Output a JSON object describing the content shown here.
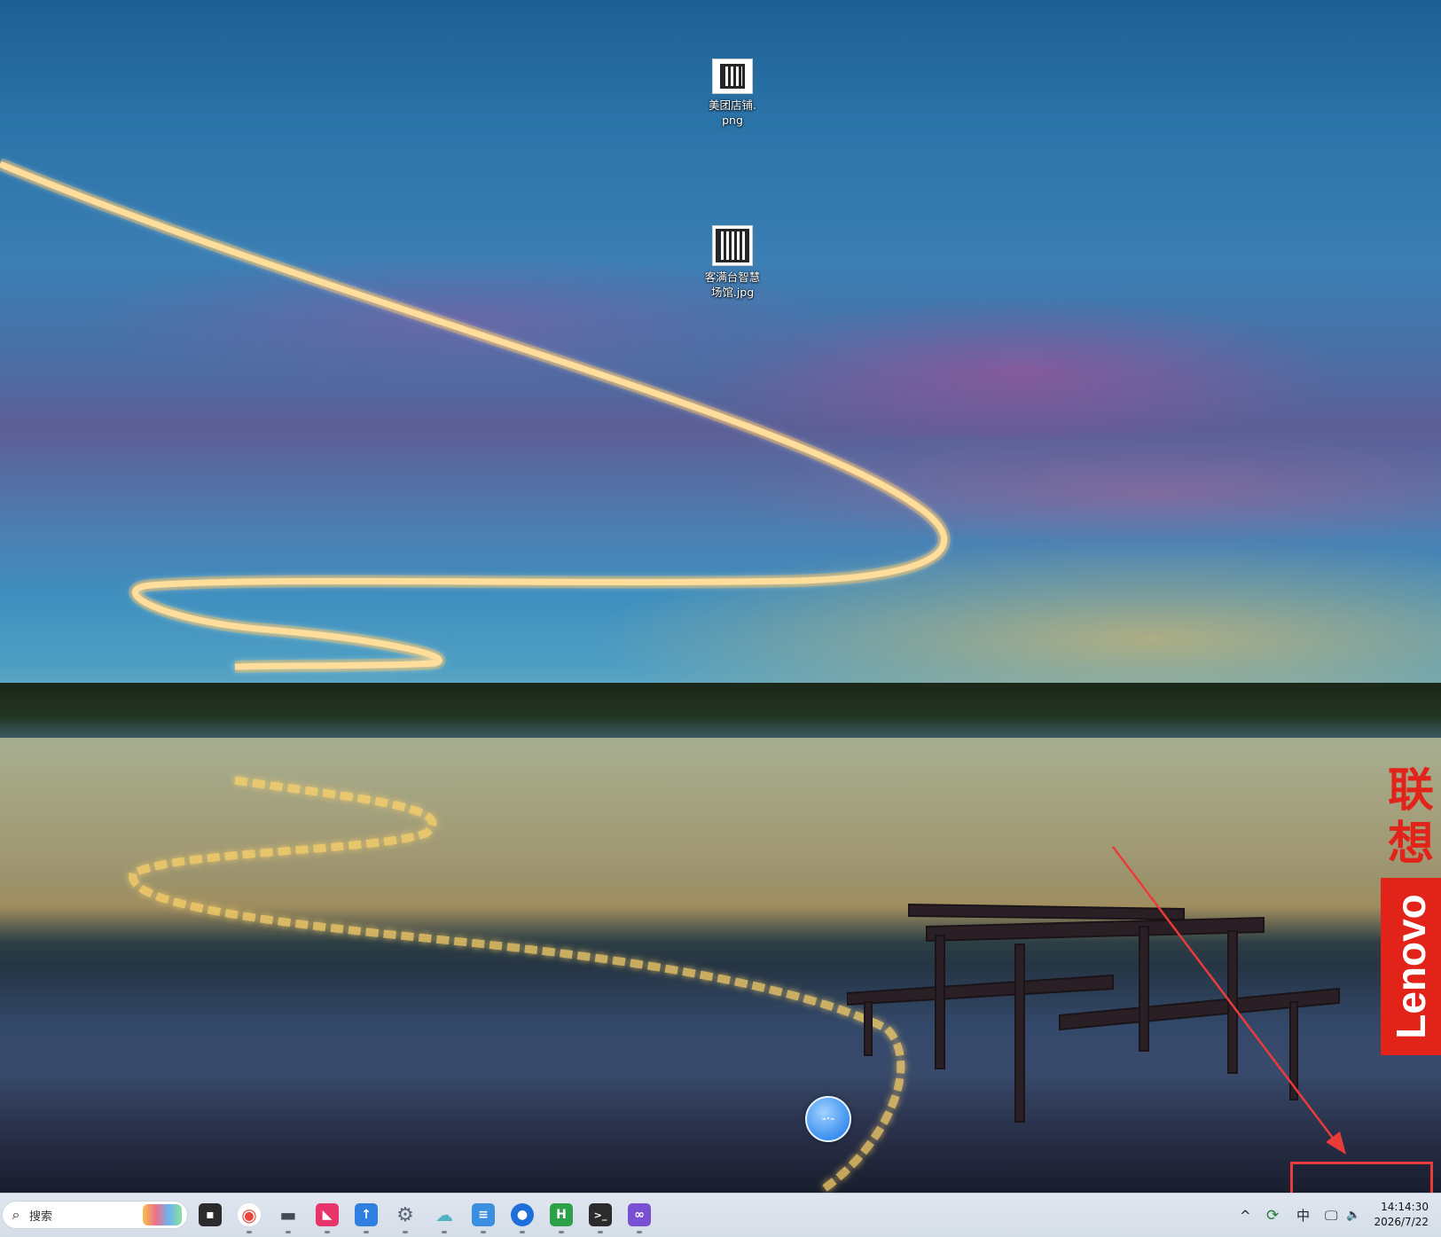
{
  "desktop": {
    "icons": [
      {
        "label": "美团店铺.\npng",
        "line1": "美团店铺.",
        "line2": "png"
      },
      {
        "label": "客满台智慧场馆.jpg",
        "line1": "客满台智慧",
        "line2": "场馆.jpg"
      }
    ],
    "branding": {
      "lenovo_cn": "联想",
      "lenovo_en": "Lenovo"
    }
  },
  "taskbar": {
    "search_placeholder": "搜索",
    "apps": [
      {
        "name": "task-view",
        "color": "#2b2b2b",
        "glyph": "▪"
      },
      {
        "name": "chrome",
        "color": "#e8453c",
        "glyph": "◉"
      },
      {
        "name": "app-dash",
        "color": "#444a52",
        "glyph": "▬"
      },
      {
        "name": "app-pink",
        "color": "#e8336b",
        "glyph": "◣"
      },
      {
        "name": "app-blue-arrow",
        "color": "#2f7fe0",
        "glyph": "↑"
      },
      {
        "name": "settings",
        "color": "#5b6472",
        "glyph": "⚙"
      },
      {
        "name": "app-cloud",
        "color": "#4fb0c6",
        "glyph": "☁"
      },
      {
        "name": "notepad",
        "color": "#3a8fe0",
        "glyph": "≡"
      },
      {
        "name": "maps",
        "color": "#1e6fd9",
        "glyph": "●"
      },
      {
        "name": "hbuilder",
        "color": "#2ea04a",
        "glyph": "H"
      },
      {
        "name": "terminal",
        "color": "#2b2b2b",
        "glyph": ">_"
      },
      {
        "name": "visual-studio",
        "color": "#7b4fd1",
        "glyph": "∞"
      }
    ],
    "tray": {
      "chevron": "^",
      "ime": "中",
      "time": "14:14:30",
      "date": "2026/7/22"
    }
  },
  "colors": {
    "annotation": "#ea3b3b",
    "lenovo_red": "#e2231a"
  }
}
